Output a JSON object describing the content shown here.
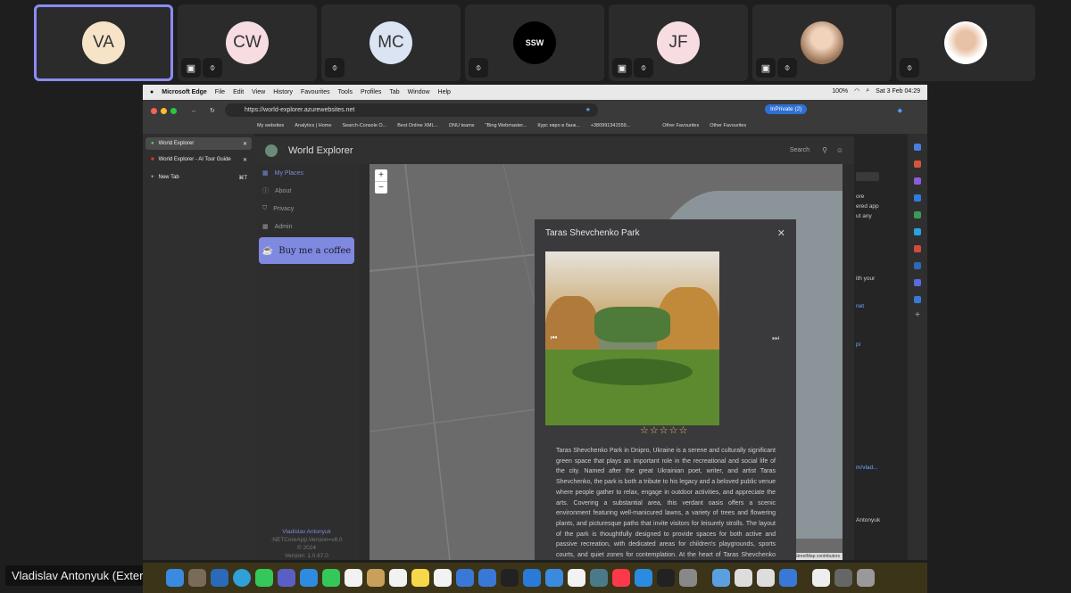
{
  "participants": [
    {
      "initials": "VA",
      "bg": "#f6e3c8",
      "active": true,
      "cam_off": false,
      "muted": false
    },
    {
      "initials": "CW",
      "bg": "#f7dde2",
      "active": false,
      "cam_off": true,
      "muted": true
    },
    {
      "initials": "MC",
      "bg": "#dbe4f3",
      "active": false,
      "cam_off": false,
      "muted": true
    },
    {
      "initials": "",
      "bg": "#000000",
      "active": false,
      "logo": "SSW",
      "cam_off": false,
      "muted": true
    },
    {
      "initials": "JF",
      "bg": "#f7dde2",
      "active": false,
      "cam_off": true,
      "muted": true
    },
    {
      "initials": "",
      "bg": "#c9a98a",
      "active": false,
      "photo": true,
      "cam_off": true,
      "muted": true
    },
    {
      "initials": "",
      "bg": "#ffffff",
      "active": false,
      "photo": true,
      "cam_off": false,
      "muted": true
    }
  ],
  "logo_text": "SSW",
  "macos_menu": {
    "brand": "Microsoft Edge",
    "items": [
      "File",
      "Edit",
      "View",
      "History",
      "Favourites",
      "Tools",
      "Profiles",
      "Tab",
      "Window",
      "Help"
    ],
    "battery": "100%",
    "clock": "Sat 3 Feb  04:29"
  },
  "browser": {
    "url": "https://world-explorer.azurewebsites.net",
    "inprivate": "InPrivate (2)",
    "favourites": [
      "My websites",
      "Analytics | Home",
      "Search-Console O...",
      "Best Online XML...",
      "DNU teams",
      "\"Bing Webmaster...",
      "Курс евро в банк...",
      "+380991341559...",
      "Other Favourites",
      "Other Favourites"
    ],
    "tabs": [
      {
        "label": "World Explorer",
        "active": true
      },
      {
        "label": "World Explorer - AI Tour Guide",
        "active": false
      },
      {
        "label": "New Tab",
        "shortcut": "⌘T"
      }
    ]
  },
  "app": {
    "title": "World Explorer",
    "search_label": "Search",
    "nav": [
      {
        "label": "My Places",
        "icon": "grid-icon",
        "active": true
      },
      {
        "label": "About",
        "icon": "info-icon"
      },
      {
        "label": "Privacy",
        "icon": "shield-icon"
      },
      {
        "label": "Admin",
        "icon": "grid-icon"
      }
    ],
    "coffee": "Buy me a coffee",
    "footer": [
      "Vladislav Antonyuk",
      ".NETCoreApp,Version=v8.0",
      "© 2024",
      "Version: 1.0.67.0"
    ]
  },
  "map": {
    "zoom_in": "+",
    "zoom_out": "−",
    "attribution": "Leaflet | © OpenStreetMap contributors"
  },
  "modal": {
    "title": "Taras Shevchenko Park",
    "close": "✕",
    "rating": 0,
    "stars": "☆☆☆☆☆",
    "description": "Taras Shevchenko Park in Dnipro, Ukraine is a serene and culturally significant green space that plays an important role in the recreational and social life of the city. Named after the great Ukrainian poet, writer, and artist Taras Shevchenko, the park is both a tribute to his legacy and a beloved public venue where people gather to relax, engage in outdoor activities, and appreciate the arts. Covering a substantial area, this verdant oasis offers a scenic environment featuring well-manicured lawns, a variety of trees and flowering plants, and picturesque paths that invite visitors for leisurely strolls. The layout of the park is thoughtfully designed to provide spaces for both active and passive recreation, with dedicated areas for children's playgrounds, sports courts, and quiet zones for contemplation. At the heart of Taras Shevchenko Park stands a prominent statue of Taras"
  },
  "right_panel": {
    "lines": [
      "ore",
      "ered app",
      "ut any",
      "ith your",
      "net",
      "pi",
      "m/vlad...",
      "Antonyuk"
    ]
  },
  "presenter": "Vladislav Antonyuk (External)"
}
